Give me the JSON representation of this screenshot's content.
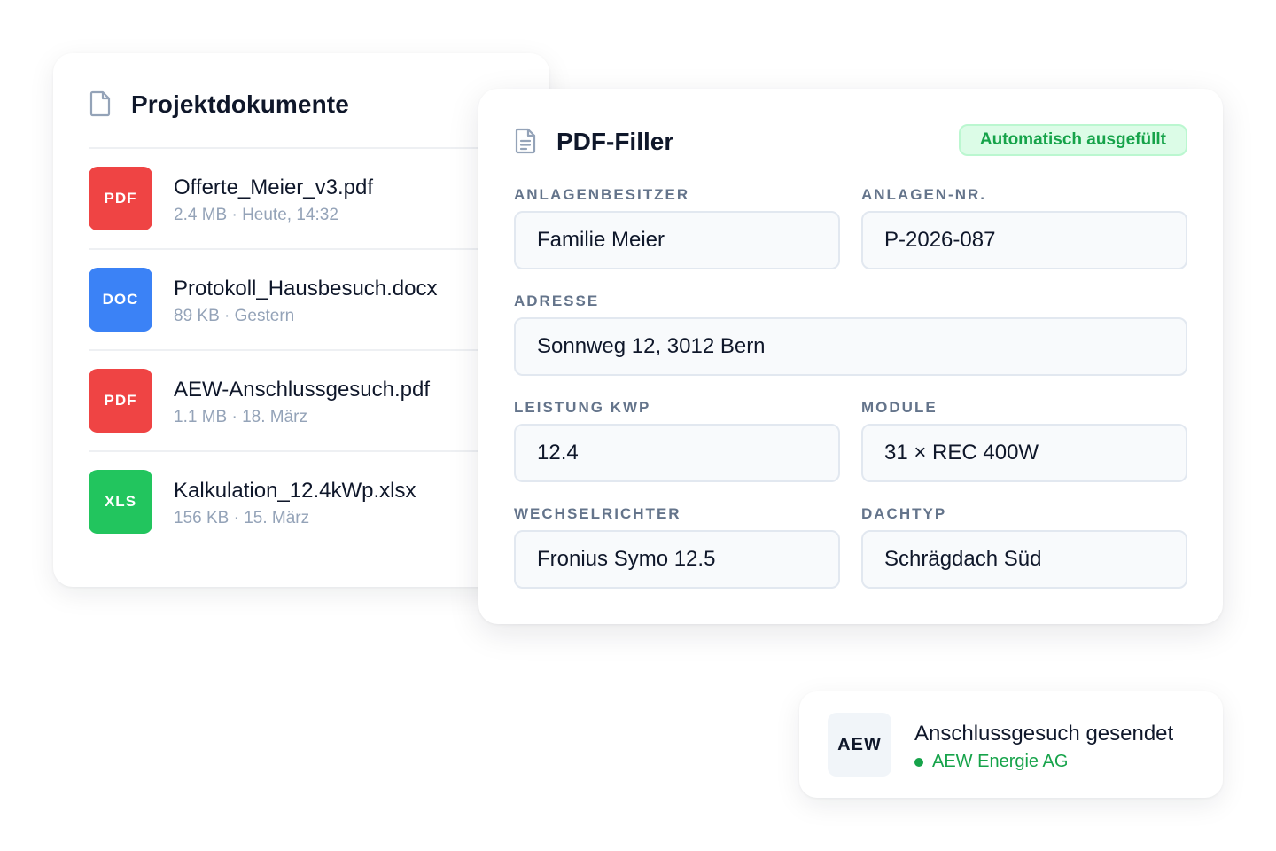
{
  "documents": {
    "title": "Projektdokumente",
    "icon": "document-icon",
    "items": [
      {
        "type": "PDF",
        "color": "#ef4444",
        "name": "Offerte_Meier_v3.pdf",
        "meta": "2.4 MB · Heute, 14:32"
      },
      {
        "type": "DOC",
        "color": "#3b82f6",
        "name": "Protokoll_Hausbesuch.docx",
        "meta": "89 KB · Gestern"
      },
      {
        "type": "PDF",
        "color": "#ef4444",
        "name": "AEW-Anschlussgesuch.pdf",
        "meta": "1.1 MB · 18. März"
      },
      {
        "type": "XLS",
        "color": "#22c55e",
        "name": "Kalkulation_12.4kWp.xlsx",
        "meta": "156 KB · 15. März"
      }
    ]
  },
  "filler": {
    "title": "PDF-Filler",
    "icon": "document-text-icon",
    "badge": "Automatisch ausgefüllt",
    "fields": {
      "owner": {
        "label": "ANLAGENBESITZER",
        "value": "Familie Meier"
      },
      "system_no": {
        "label": "ANLAGEN-NR.",
        "value": "P-2026-087"
      },
      "address": {
        "label": "ADRESSE",
        "value": "Sonnweg 12, 3012 Bern"
      },
      "power": {
        "label": "LEISTUNG KWP",
        "value": "12.4"
      },
      "modules": {
        "label": "MODULE",
        "value": "31 × REC 400W"
      },
      "inverter": {
        "label": "WECHSELRICHTER",
        "value": "Fronius Symo 12.5"
      },
      "roof": {
        "label": "DACHTYP",
        "value": "Schrägdach Süd"
      }
    }
  },
  "notification": {
    "logo": "AEW",
    "title": "Anschlussgesuch gesendet",
    "subtitle": "AEW Energie AG",
    "status_color": "#16a34a"
  }
}
